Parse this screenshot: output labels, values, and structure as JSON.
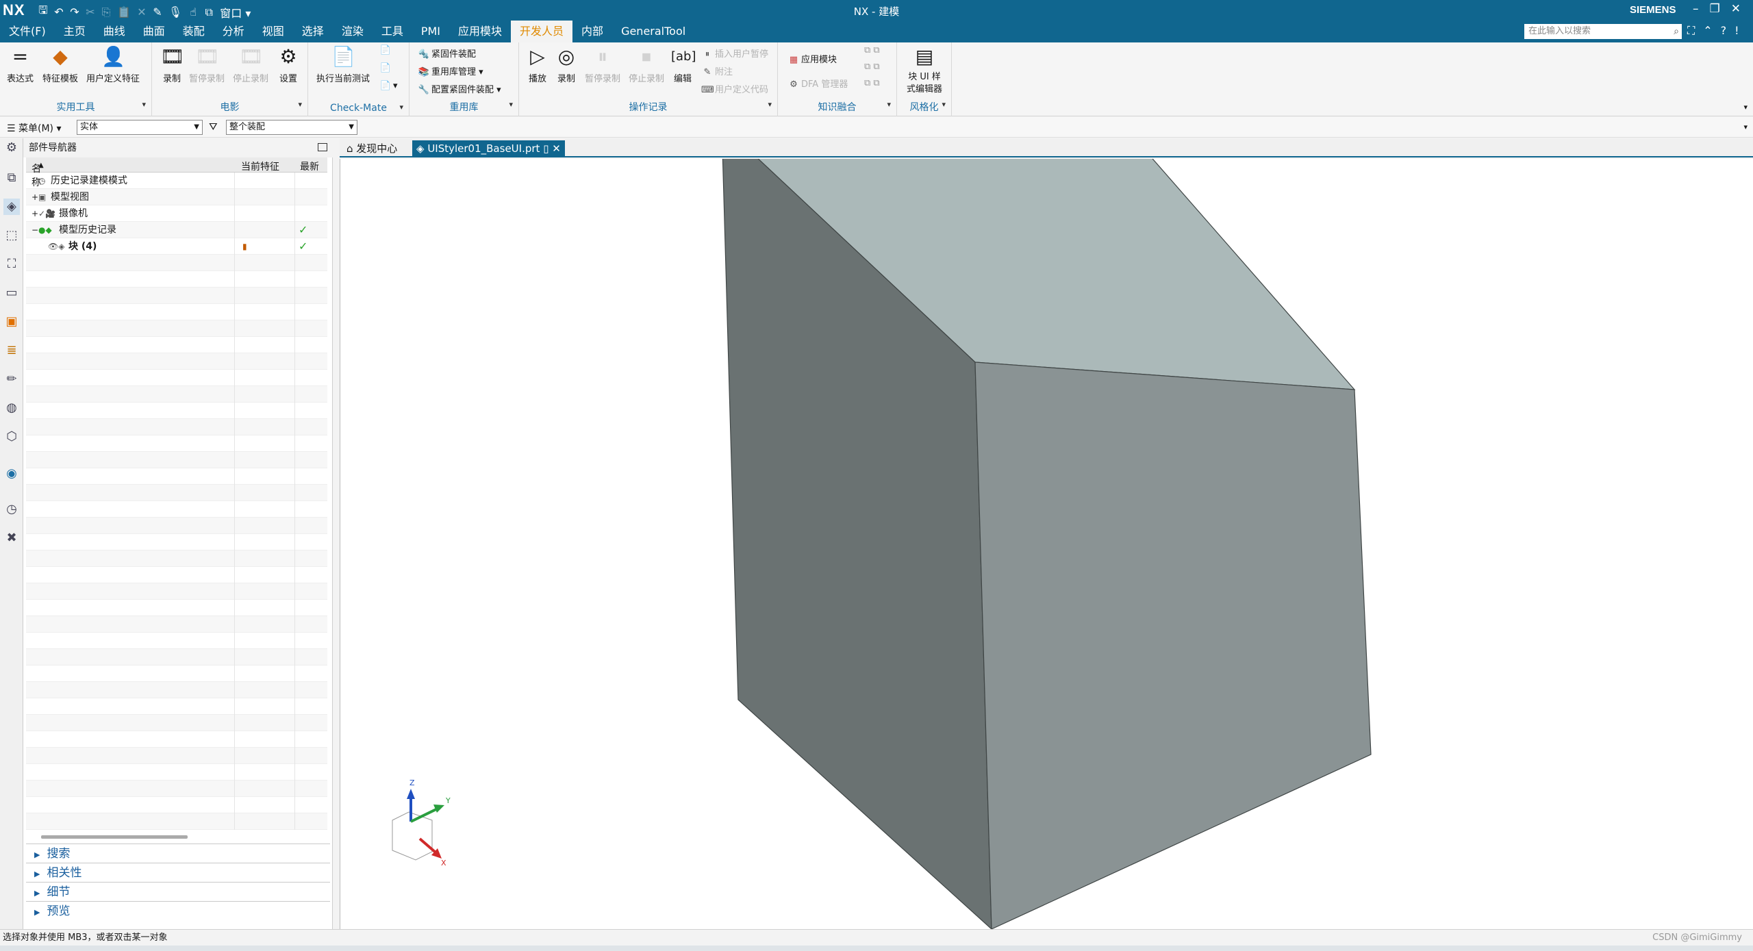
{
  "window": {
    "logo": "NX",
    "title": "NX - 建模",
    "brand": "SIEMENS",
    "qat_window_label": "窗口"
  },
  "menu": {
    "tabs": [
      "文件(F)",
      "主页",
      "曲线",
      "曲面",
      "装配",
      "分析",
      "视图",
      "选择",
      "渲染",
      "工具",
      "PMI",
      "应用模块",
      "开发人员",
      "内部",
      "GeneralTool"
    ],
    "active_tab": "开发人员",
    "search_placeholder": "在此输入以搜索"
  },
  "ribbon": {
    "groups": {
      "utility": "实用工具",
      "movie": "电影",
      "checkmate": "Check-Mate",
      "reuse": "重用库",
      "record": "操作记录",
      "kf": "知识融合",
      "style": "风格化"
    },
    "utility": {
      "expression": "表达式",
      "feature_template": "特征模板",
      "user_feature": "用户定义特征"
    },
    "movie": {
      "record": "录制",
      "pause": "暂停录制",
      "stop": "停止录制",
      "settings": "设置"
    },
    "checkmate": {
      "run": "执行当前测试"
    },
    "reuse": {
      "fastener": "紧固件装配",
      "library": "重用库管理",
      "config": "配置紧固件装配"
    },
    "record": {
      "play": "播放",
      "rec": "录制",
      "pause": "暂停录制",
      "stop": "停止录制",
      "edit": "编辑",
      "insert_pause": "插入用户暂停",
      "note": "附注",
      "user_code": "用户定义代码"
    },
    "kf": {
      "app_module": "应用模块",
      "dfa": "DFA 管理器"
    },
    "style": {
      "block_ui": "块 UI 样式编辑器"
    }
  },
  "selbar": {
    "menu_label": "菜单(M)",
    "type_filter": "实体",
    "scope": "整个装配"
  },
  "navigator": {
    "title": "部件导航器",
    "col_name": "名称",
    "col_current": "当前特征",
    "col_latest": "最新",
    "rows": [
      {
        "label": "历史记录建模模式"
      },
      {
        "label": "模型视图"
      },
      {
        "label": "摄像机"
      },
      {
        "label": "模型历史记录"
      },
      {
        "label": "块 (4)"
      }
    ],
    "panes": [
      "搜索",
      "相关性",
      "细节",
      "预览"
    ]
  },
  "doctabs": {
    "discovery": "发现中心",
    "part": "UIStyler01_BaseUI.prt"
  },
  "triad": {
    "x": "X",
    "y": "Y",
    "z": "Z"
  },
  "status": {
    "message": "选择对象并使用 MB3，或者双击某一对象",
    "watermark": "CSDN @GimiGimmy"
  },
  "colors": {
    "chrome": "#10668f",
    "active_tab_text": "#e08a00",
    "cube_top": "#abb9b9",
    "cube_left": "#6a7272",
    "cube_right": "#8a9394"
  }
}
